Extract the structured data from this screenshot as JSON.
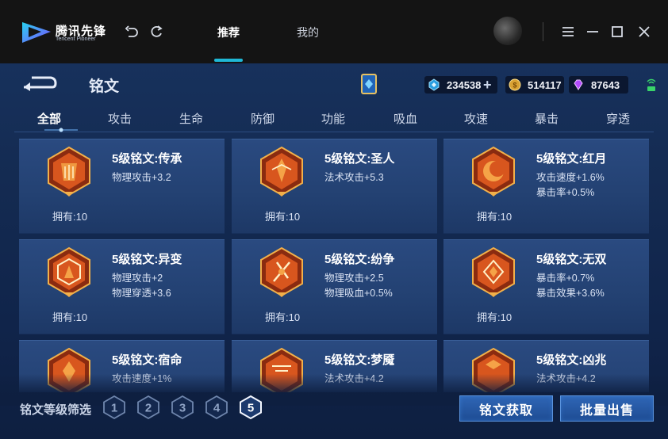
{
  "titlebar": {
    "brand_cn": "腾讯先锋",
    "brand_en": "Tencent Pioneer",
    "tabs": [
      "推荐",
      "我的"
    ],
    "active_tab": "推荐"
  },
  "header": {
    "title": "铭文",
    "currencies": [
      {
        "name": "diamond-coupon",
        "value": "234538"
      },
      {
        "name": "gold-coin",
        "value": "514117"
      },
      {
        "name": "gem",
        "value": "87643"
      }
    ]
  },
  "tabs": [
    "全部",
    "攻击",
    "生命",
    "防御",
    "功能",
    "吸血",
    "攻速",
    "暴击",
    "穿透"
  ],
  "active_tab": "全部",
  "cards": [
    {
      "name": "5级铭文:传承",
      "attrs": [
        "物理攻击+3.2"
      ],
      "owned": "拥有:10"
    },
    {
      "name": "5级铭文:圣人",
      "attrs": [
        "法术攻击+5.3"
      ],
      "owned": "拥有:10"
    },
    {
      "name": "5级铭文:红月",
      "attrs": [
        "攻击速度+1.6%",
        "暴击率+0.5%"
      ],
      "owned": "拥有:10"
    },
    {
      "name": "5级铭文:异变",
      "attrs": [
        "物理攻击+2",
        "物理穿透+3.6"
      ],
      "owned": "拥有:10"
    },
    {
      "name": "5级铭文:纷争",
      "attrs": [
        "物理攻击+2.5",
        "物理吸血+0.5%"
      ],
      "owned": "拥有:10"
    },
    {
      "name": "5级铭文:无双",
      "attrs": [
        "暴击率+0.7%",
        "暴击效果+3.6%"
      ],
      "owned": "拥有:10"
    },
    {
      "name": "5级铭文:宿命",
      "attrs": [
        "攻击速度+1%"
      ],
      "owned": ""
    },
    {
      "name": "5级铭文:梦魇",
      "attrs": [
        "法术攻击+4.2"
      ],
      "owned": ""
    },
    {
      "name": "5级铭文:凶兆",
      "attrs": [
        "法术攻击+4.2"
      ],
      "owned": ""
    }
  ],
  "footer": {
    "filter_label": "铭文等级筛选",
    "levels": [
      "1",
      "2",
      "3",
      "4",
      "5"
    ],
    "selected_level": "5",
    "get_button": "铭文获取",
    "sell_button": "批量出售"
  },
  "colors": {
    "accent": "#1fb8d6",
    "emblem": "#d8561e",
    "emblem_rim": "#f2b04a",
    "button": "#2f66b6"
  }
}
